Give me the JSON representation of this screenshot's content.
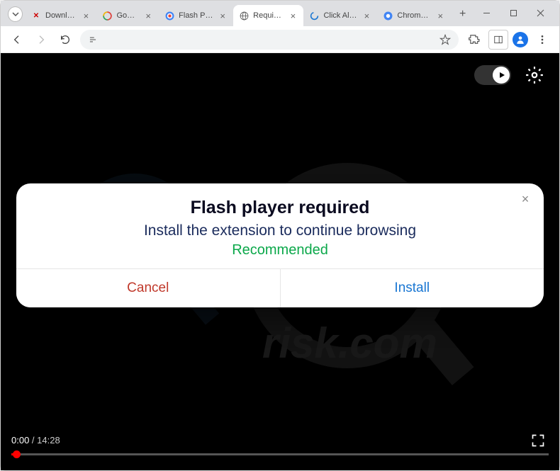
{
  "tabs": [
    {
      "title": "Download",
      "active": false,
      "icon_color": "#c00",
      "icon_text": "X"
    },
    {
      "title": "Google",
      "active": false,
      "icon": "google"
    },
    {
      "title": "Flash Playe",
      "active": false,
      "icon": "flash"
    },
    {
      "title": "Required!",
      "active": true,
      "icon": "globe"
    },
    {
      "title": "Click Allow",
      "active": false,
      "icon": "c-blue"
    },
    {
      "title": "Chrome W",
      "active": false,
      "icon": "chrome-store"
    }
  ],
  "dialog": {
    "title": "Flash player required",
    "subtitle": "Install the extension to continue browsing",
    "recommended": "Recommended",
    "cancel": "Cancel",
    "install": "Install"
  },
  "video": {
    "current_time": "0:00",
    "total_time": "14:28",
    "separator": " / "
  }
}
